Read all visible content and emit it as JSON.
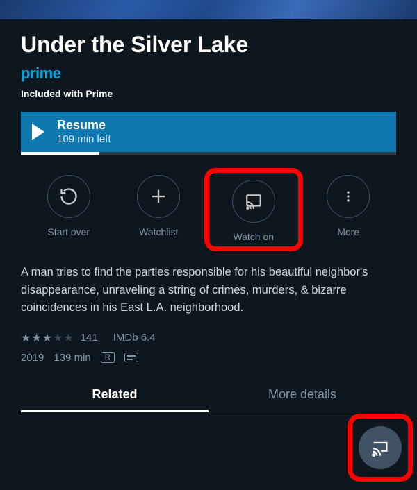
{
  "title": "Under the Silver Lake",
  "prime_label": "prime",
  "included_label": "Included with Prime",
  "resume": {
    "label": "Resume",
    "time_left": "109 min left",
    "progress_pct": 21
  },
  "actions": {
    "start_over": "Start over",
    "watchlist": "Watchlist",
    "watch_on": "Watch on",
    "more": "More"
  },
  "synopsis": "A man tries to find the parties responsible for his beautiful neighbor's disappearance, unraveling a string of crimes, murders, & bizarre coincidences in his East L.A. neighborhood.",
  "rating": {
    "stars_filled": 3,
    "stars_total": 5,
    "count": "141",
    "imdb": "IMDb 6.4"
  },
  "meta": {
    "year": "2019",
    "runtime": "139 min",
    "mpaa": "R"
  },
  "tabs": {
    "related": "Related",
    "more_details": "More details"
  }
}
